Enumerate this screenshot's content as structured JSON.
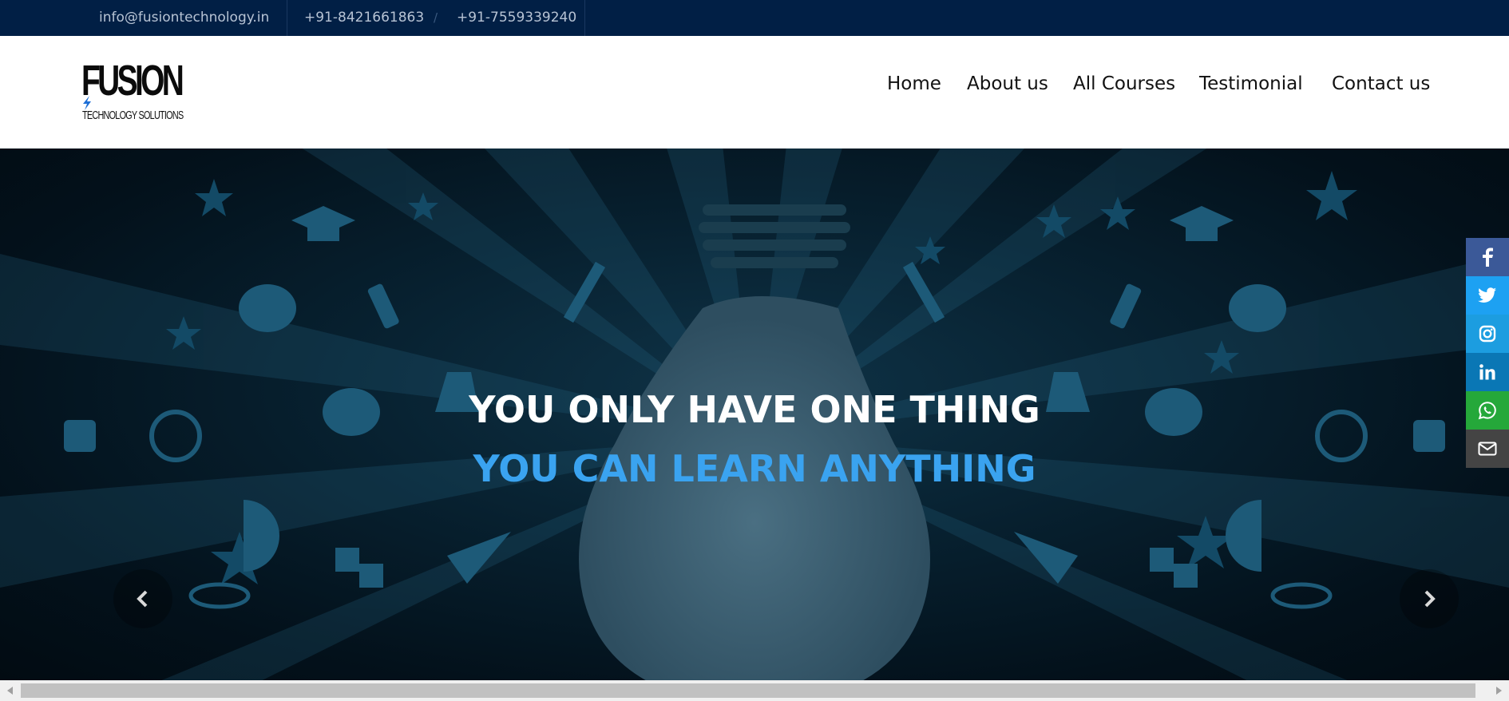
{
  "topbar": {
    "email": "info@fusiontechnology.in",
    "phone1": "+91-8421661863",
    "phone2": "+91-7559339240",
    "separator": "/"
  },
  "logo": {
    "word": "FUSION",
    "tagline": "TECHNOLOGY SOLUTIONS",
    "accent_color": "#1e6fd6"
  },
  "nav": {
    "items": [
      {
        "label": "Home"
      },
      {
        "label": "About us"
      },
      {
        "label": "All Courses"
      },
      {
        "label": "Testimonial"
      },
      {
        "label": "Contact us"
      }
    ]
  },
  "hero": {
    "headline_1": "YOU ONLY HAVE ONE THING",
    "headline_2": "YOU CAN LEARN ANYTHING",
    "headline_1_color": "#ffffff",
    "headline_2_color": "#3aa3f0",
    "prev_icon": "chevron-left-icon",
    "next_icon": "chevron-right-icon"
  },
  "social": [
    {
      "name": "facebook",
      "icon": "facebook-icon",
      "color": "#3b5998"
    },
    {
      "name": "twitter",
      "icon": "twitter-icon",
      "color": "#1da1f2"
    },
    {
      "name": "instagram",
      "icon": "instagram-icon",
      "color": "#1c9de0"
    },
    {
      "name": "linkedin",
      "icon": "linkedin-icon",
      "color": "#0a77b5"
    },
    {
      "name": "whatsapp",
      "icon": "whatsapp-icon",
      "color": "#25a83a"
    },
    {
      "name": "email",
      "icon": "envelope-icon",
      "color": "#444444"
    }
  ],
  "colors": {
    "topbar_bg": "#011f45",
    "header_bg": "#ffffff",
    "hero_bg": "#061b28",
    "icon_fill": "#1d5a78"
  }
}
